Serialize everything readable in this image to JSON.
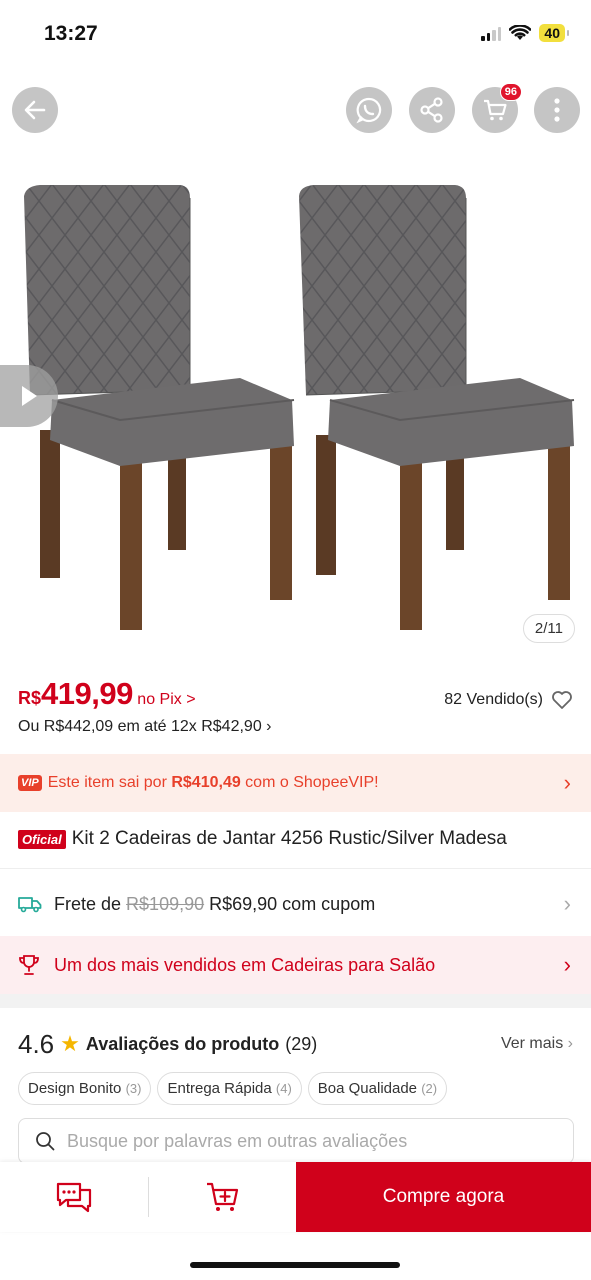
{
  "status_bar": {
    "time": "13:27",
    "battery": "40"
  },
  "cart": {
    "badge": "96"
  },
  "gallery": {
    "counter": "2/11"
  },
  "price": {
    "currency": "R$",
    "value": "419,99",
    "pix": "no Pix >",
    "sold": "82 Vendido(s)",
    "installments": "Ou R$442,09 em até 12x R$42,90 ›"
  },
  "vip": {
    "badge": "VIP",
    "text_before": "Este item sai por ",
    "text_price": "R$410,49",
    "text_after": " com o ShopeeVIP!"
  },
  "product": {
    "badge": "Oficial",
    "title": "Kit 2 Cadeiras de Jantar 4256 Rustic/Silver Madesa"
  },
  "shipping": {
    "prefix": "Frete de ",
    "old_price": "R$109,90",
    "new_price": " R$69,90 com cupom"
  },
  "best_seller": {
    "text": "Um dos mais vendidos em Cadeiras para Salão"
  },
  "reviews": {
    "rating": "4.6",
    "title": "Avaliações do produto",
    "count": "(29)",
    "see_more": "Ver mais",
    "tags": [
      {
        "label": "Design Bonito",
        "count": "(3)"
      },
      {
        "label": "Entrega Rápida",
        "count": "(4)"
      },
      {
        "label": "Boa Qualidade",
        "count": "(2)"
      }
    ],
    "search_placeholder": "Busque por palavras em outras avaliações"
  },
  "bottom_bar": {
    "buy_label": "Compre agora"
  },
  "colors": {
    "brand_red": "#d0011b",
    "vip_orange": "#e8402b",
    "star": "#f5b600"
  }
}
